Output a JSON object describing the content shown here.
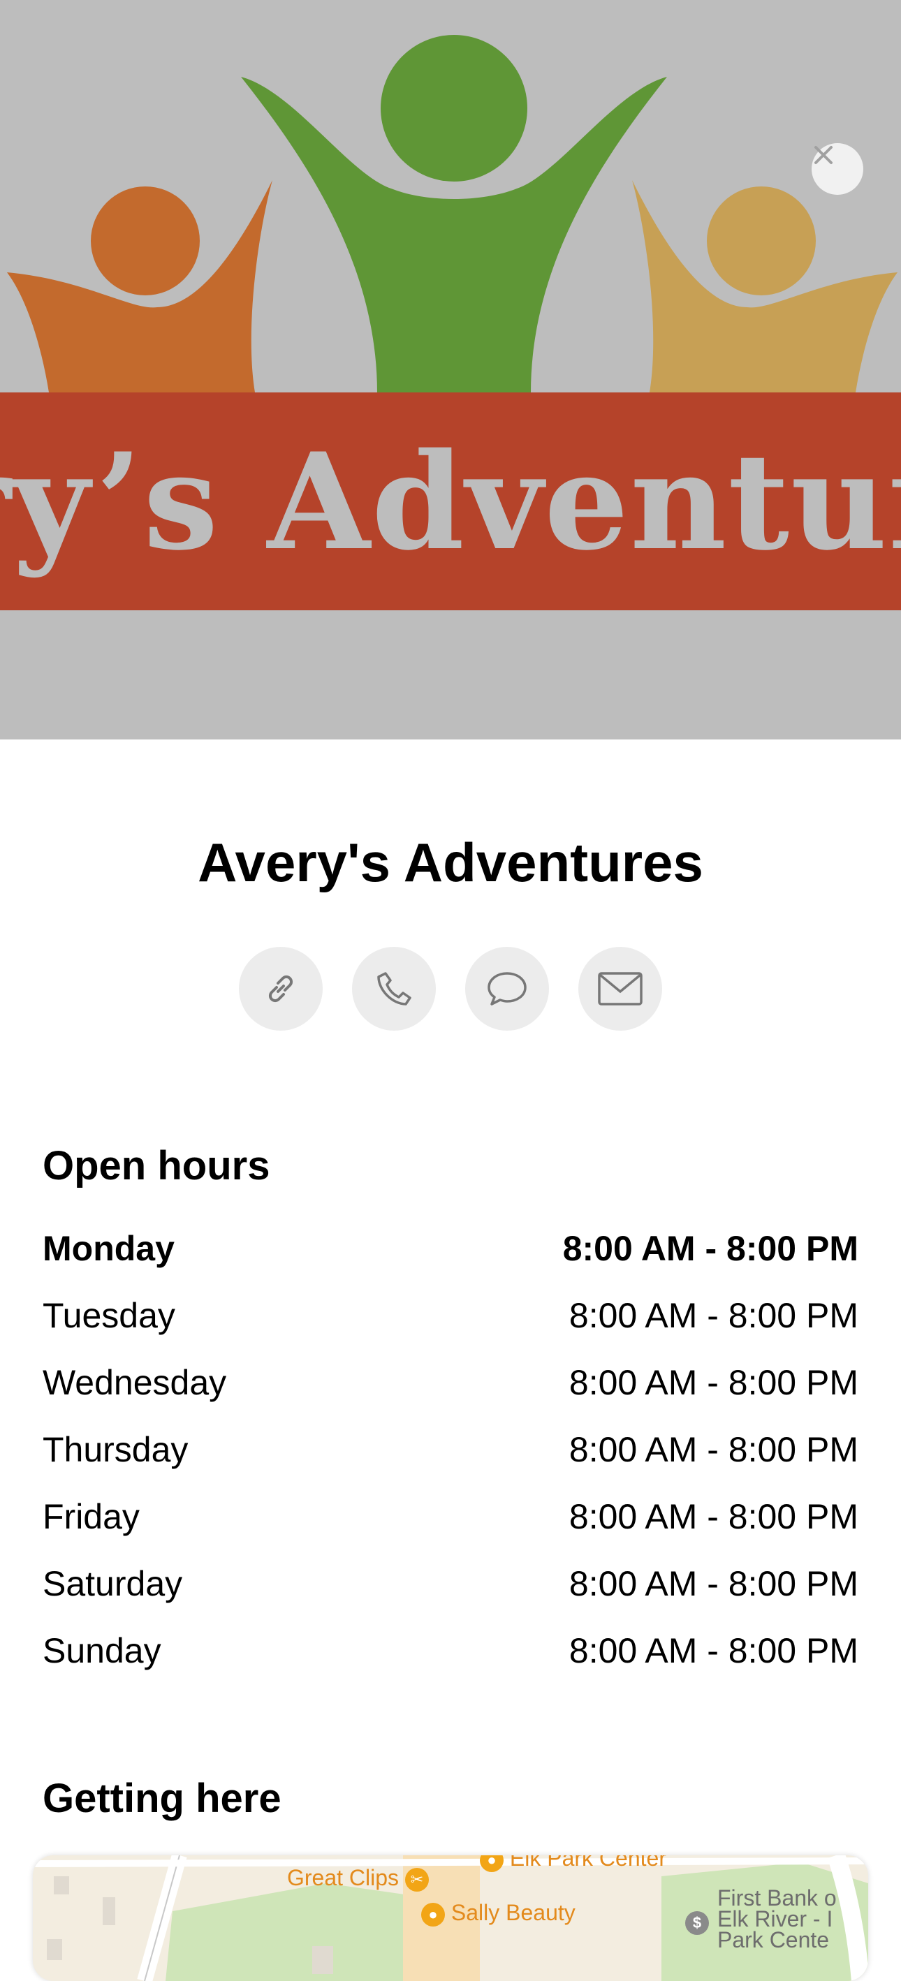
{
  "hero": {
    "banner_text": "ery’s Adventure",
    "banner_color": "#b5432a",
    "figure_colors": {
      "left": "#c36a2d",
      "center": "#5f9636",
      "right": "#c7a055"
    }
  },
  "close_icon": "close-icon",
  "business": {
    "name": "Avery's Adventures"
  },
  "actions": [
    {
      "icon": "link-icon"
    },
    {
      "icon": "phone-icon"
    },
    {
      "icon": "message-icon"
    },
    {
      "icon": "mail-icon"
    }
  ],
  "open_hours": {
    "title": "Open hours",
    "days": [
      {
        "day": "Monday",
        "hours": "8:00 AM - 8:00 PM",
        "today": true
      },
      {
        "day": "Tuesday",
        "hours": "8:00 AM - 8:00 PM"
      },
      {
        "day": "Wednesday",
        "hours": "8:00 AM - 8:00 PM"
      },
      {
        "day": "Thursday",
        "hours": "8:00 AM - 8:00 PM"
      },
      {
        "day": "Friday",
        "hours": "8:00 AM - 8:00 PM"
      },
      {
        "day": "Saturday",
        "hours": "8:00 AM - 8:00 PM"
      },
      {
        "day": "Sunday",
        "hours": "8:00 AM - 8:00 PM"
      }
    ]
  },
  "getting_here": {
    "title": "Getting here",
    "map_labels": {
      "elk_park_center": "Elk Park Center",
      "great_clips": "Great Clips",
      "sally_beauty": "Sally Beauty",
      "first_bank_line1": "First Bank o",
      "first_bank_line2": "Elk River - I",
      "first_bank_line3": "Park Cente"
    }
  }
}
